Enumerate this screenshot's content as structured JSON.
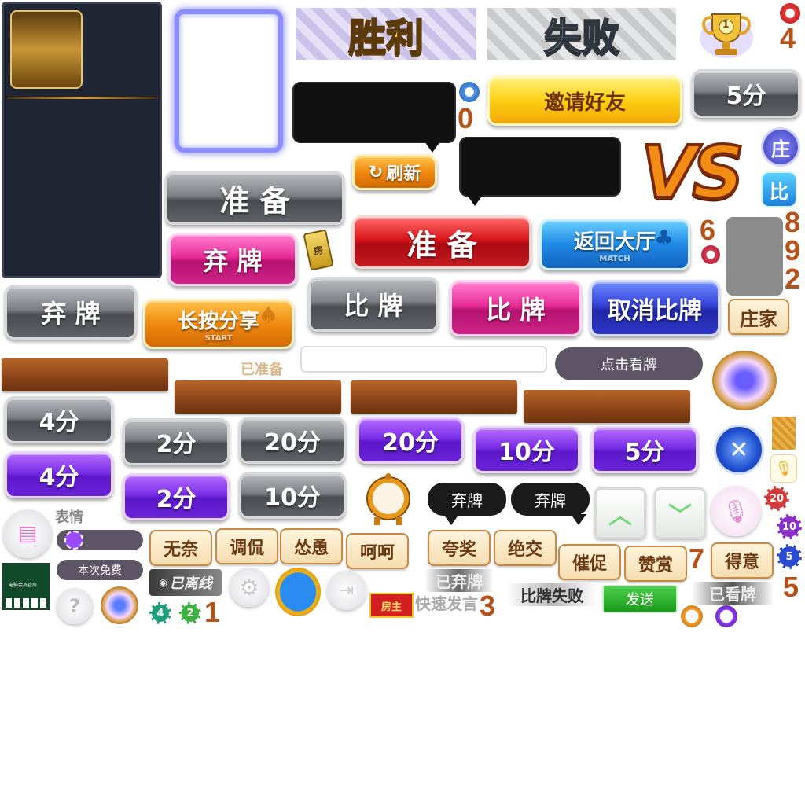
{
  "banners": {
    "victory": "胜利",
    "defeat": "失败",
    "vs": "VS"
  },
  "buttons": {
    "invite_friends": "邀请好友",
    "refresh": "刷新",
    "ready_gray": "准 备",
    "ready_red": "准 备",
    "fold_pink": "弃 牌",
    "fold_gray": "弃 牌",
    "back_lobby": "返回大厅",
    "back_lobby_sub": "MATCH",
    "long_press_share": "长按分享",
    "long_press_share_sub": "START",
    "compare_gray": "比 牌",
    "compare_pink": "比 牌",
    "cancel_compare": "取消比牌",
    "click_view_cards": "点击看牌",
    "send": "发送"
  },
  "score_buttons": {
    "gray_5": "5分",
    "gray_4": "4分",
    "purple_4": "4分",
    "gray_2": "2分",
    "gray_20": "20分",
    "purple_20": "20分",
    "purple_10": "10分",
    "purple_5": "5分",
    "purple_2": "2分",
    "gray_10": "10分"
  },
  "badges": {
    "dealer_circle": "庄",
    "compare_square": "比",
    "dealer_label": "庄家",
    "room_tag": "房",
    "room_owner": "房主"
  },
  "status": {
    "ready": "已准备",
    "offline": "已离线",
    "folded": "已弃牌",
    "quick_speech": "快速发言",
    "compare_failed": "比牌失败",
    "viewed": "已看牌"
  },
  "chat": {
    "emoji_label": "表情",
    "free_this_time": "本次免费",
    "bubble_left": "弃牌",
    "bubble_right": "弃牌"
  },
  "phrases": [
    "无奈",
    "调侃",
    "怂恿",
    "呵呵",
    "夸奖",
    "绝交",
    "催促",
    "赞赏",
    "得意"
  ],
  "digits": {
    "d4_top": "4",
    "d0": "0",
    "d6": "6",
    "d8": "8",
    "d9": "9",
    "d2": "2",
    "d1": "1",
    "d3": "3",
    "d7": "7",
    "d5": "5"
  },
  "chips": {
    "c20": "20",
    "c10": "10",
    "c5": "5",
    "c4": "4",
    "c2": "2"
  },
  "trophy_rank": "1",
  "thumbnail_title": "电脑会员包房",
  "colors": {
    "accent_orange": "#b4521a",
    "panel_dark": "#1f2533",
    "purple": "#6a24d8",
    "gray": "#6a6d72",
    "wood": "#8a4318"
  },
  "icons": [
    "trophy-icon",
    "chevron-up-icon",
    "chevron-down-icon",
    "microphone-icon",
    "close-icon",
    "gear-icon",
    "exit-icon",
    "question-icon",
    "message-icon",
    "club-suit-icon",
    "spade-suit-icon",
    "refresh-arrow-icon",
    "alarm-clock-icon",
    "wifi-icon"
  ]
}
